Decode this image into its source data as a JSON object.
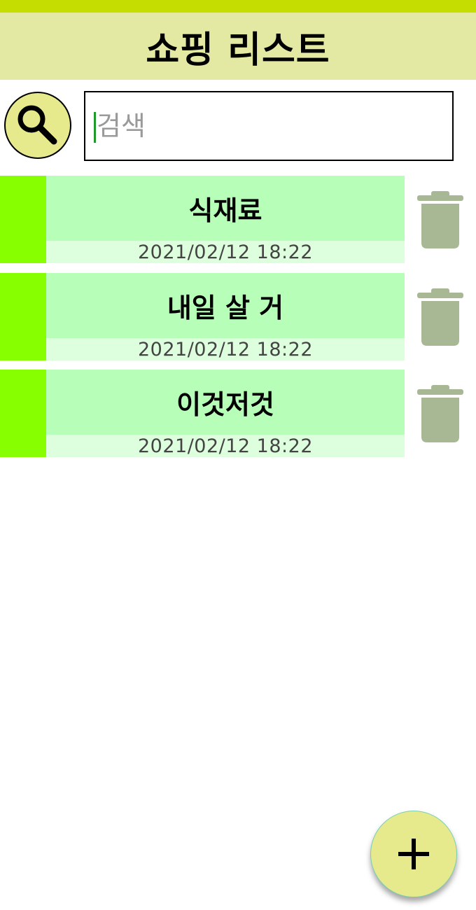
{
  "app_bar": {
    "title": "쇼핑 리스트"
  },
  "search": {
    "icon": "search-icon",
    "placeholder": "검색",
    "value": ""
  },
  "list": {
    "items": [
      {
        "title": "식재료",
        "date": "2021/02/12 18:22",
        "delete_icon": "trash-icon"
      },
      {
        "title": "내일 살 거",
        "date": "2021/02/12 18:22",
        "delete_icon": "trash-icon"
      },
      {
        "title": "이것저것",
        "date": "2021/02/12 18:22",
        "delete_icon": "trash-icon"
      }
    ]
  },
  "fab": {
    "icon": "plus-icon"
  },
  "colors": {
    "status_bar": "#c5dd00",
    "app_bar": "#e3e8a3",
    "item_accent": "#88ff00",
    "item_title_band": "#b7ffb9",
    "item_date_band": "#ddffdd",
    "trash": "#a8b894",
    "fab": "#e6e98c"
  }
}
